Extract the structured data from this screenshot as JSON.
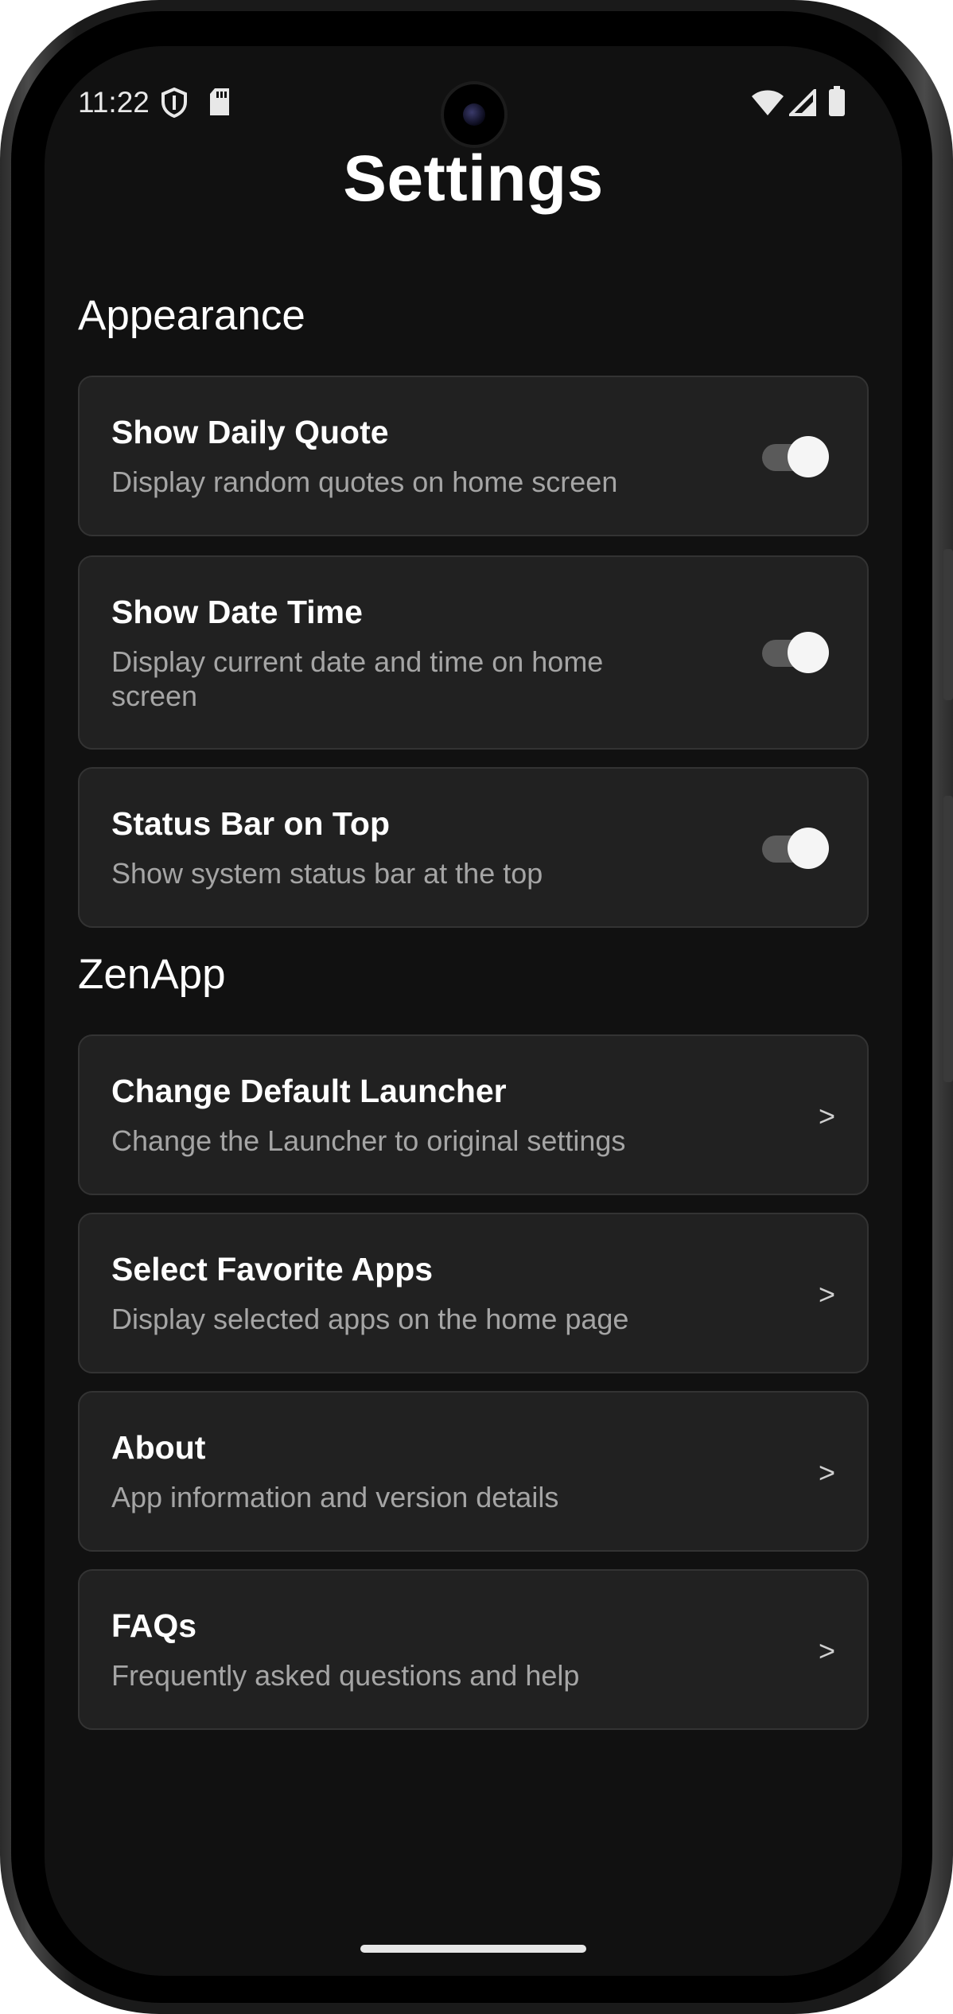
{
  "status_bar": {
    "time": "11:22",
    "icons": [
      "shield-icon",
      "sd-card-icon",
      "wifi-icon",
      "signal-icon",
      "battery-icon"
    ]
  },
  "page_title": "Settings",
  "sections": {
    "appearance": {
      "label": "Appearance",
      "items": [
        {
          "title": "Show Daily Quote",
          "subtitle": "Display random quotes on home screen",
          "enabled": true
        },
        {
          "title": "Show Date Time",
          "subtitle": "Display current date and time on home screen",
          "enabled": true
        },
        {
          "title": "Status Bar on Top",
          "subtitle": "Show system status bar at the top",
          "enabled": true
        }
      ]
    },
    "zenapp": {
      "label": "ZenApp",
      "items": [
        {
          "title": "Change Default Launcher",
          "subtitle": "Change the Launcher to original settings",
          "chevron": ">"
        },
        {
          "title": "Select Favorite Apps",
          "subtitle": "Display selected apps on the home page",
          "chevron": ">"
        },
        {
          "title": "About",
          "subtitle": "App information and version details",
          "chevron": ">"
        },
        {
          "title": "FAQs",
          "subtitle": "Frequently asked questions and help",
          "chevron": ">"
        }
      ]
    }
  },
  "colors": {
    "background": "#111111",
    "card": "#212121",
    "card_border": "#333333",
    "subtitle_text": "#a5a5a5",
    "toggle_track": "#5a5a5a",
    "toggle_thumb": "#f5f5f5"
  }
}
